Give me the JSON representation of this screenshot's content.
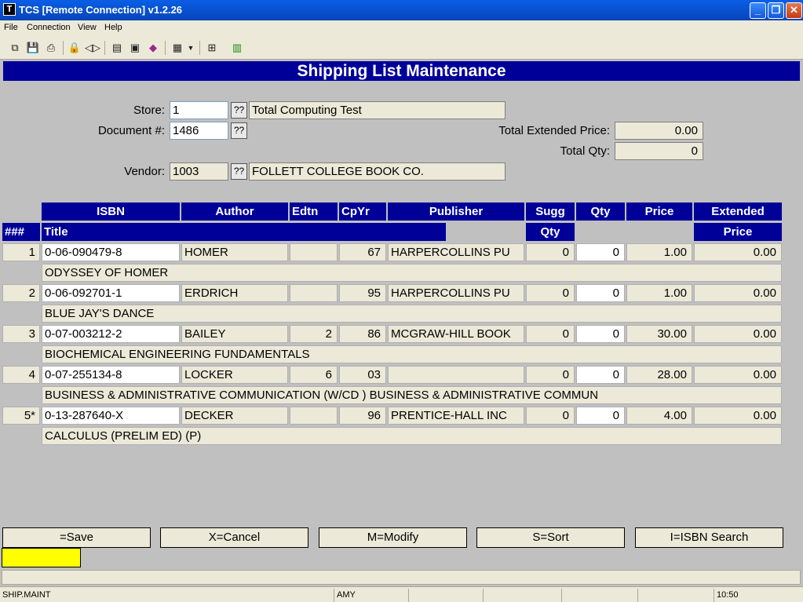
{
  "window": {
    "title": "TCS [Remote Connection]  v1.2.26",
    "icon_letter": "T"
  },
  "menu": [
    "File",
    "Connection",
    "View",
    "Help"
  ],
  "toolbar_icons": [
    "copy-icon",
    "save-icon",
    "print-icon",
    "lock-icon",
    "sound-icon",
    "properties-icon",
    "monitor-icon",
    "book-icon",
    "document-icon",
    "dropdown-arrow-icon",
    "network-icon",
    "chart-icon"
  ],
  "page": {
    "heading": "Shipping List Maintenance"
  },
  "form": {
    "store_label": "Store:",
    "store_value": "1",
    "store_lookup": "??",
    "store_name": "Total Computing Test",
    "document_label": "Document #:",
    "document_value": "1486",
    "document_lookup": "??",
    "vendor_label": "Vendor:",
    "vendor_value": "1003",
    "vendor_lookup": "??",
    "vendor_name": "FOLLETT COLLEGE BOOK CO.",
    "total_extended_label": "Total Extended Price:",
    "total_extended_value": "0.00",
    "total_qty_label": "Total Qty:",
    "total_qty_value": "0"
  },
  "table": {
    "headers_row1": [
      "ISBN",
      "Author",
      "Edtn",
      "CpYr",
      "Publisher",
      "Sugg",
      "Qty",
      "Price",
      "Extended"
    ],
    "headers_row2": {
      "num": "###",
      "title": "Title",
      "sugg": "Qty",
      "extended": "Price"
    },
    "rows": [
      {
        "num": "1",
        "isbn": "0-06-090479-8",
        "author": "HOMER",
        "edtn": "",
        "cpyr": "67",
        "publisher": "HARPERCOLLINS PU",
        "sugg": "0",
        "qty": "0",
        "price": "1.00",
        "extended": "0.00",
        "title": "ODYSSEY OF HOMER"
      },
      {
        "num": "2",
        "isbn": "0-06-092701-1",
        "author": "ERDRICH",
        "edtn": "",
        "cpyr": "95",
        "publisher": "HARPERCOLLINS PU",
        "sugg": "0",
        "qty": "0",
        "price": "1.00",
        "extended": "0.00",
        "title": "BLUE JAY'S DANCE"
      },
      {
        "num": "3",
        "isbn": "0-07-003212-2",
        "author": "BAILEY",
        "edtn": "2",
        "cpyr": "86",
        "publisher": "MCGRAW-HILL BOOK",
        "sugg": "0",
        "qty": "0",
        "price": "30.00",
        "extended": "0.00",
        "title": "BIOCHEMICAL ENGINEERING FUNDAMENTALS"
      },
      {
        "num": "4",
        "isbn": "0-07-255134-8",
        "author": "LOCKER",
        "edtn": "6",
        "cpyr": "03",
        "publisher": "",
        "sugg": "0",
        "qty": "0",
        "price": "28.00",
        "extended": "0.00",
        "title": "BUSINESS & ADMINISTRATIVE COMMUNICATION (W/CD ) BUSINESS & ADMINISTRATIVE COMMUN"
      },
      {
        "num": "5*",
        "isbn": "0-13-287640-X",
        "author": "DECKER",
        "edtn": "",
        "cpyr": "96",
        "publisher": "PRENTICE-HALL INC",
        "sugg": "0",
        "qty": "0",
        "price": "4.00",
        "extended": "0.00",
        "title": "CALCULUS (PRELIM ED) (P)"
      }
    ]
  },
  "buttons": [
    "=Save",
    "X=Cancel",
    "M=Modify",
    "S=Sort",
    "I=ISBN Search"
  ],
  "status": {
    "screen": "SHIP.MAINT",
    "user": "AMY",
    "time": "10:50"
  }
}
